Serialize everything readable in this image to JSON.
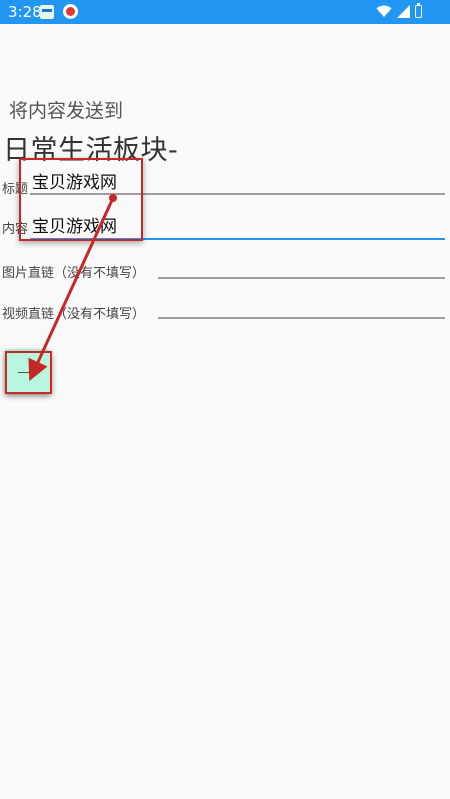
{
  "status_bar": {
    "time": "3:28",
    "icons": [
      "notification-app-icon",
      "red-badge-app-icon",
      "wifi-icon",
      "cellular-signal-icon",
      "battery-icon"
    ]
  },
  "page": {
    "subtitle": "将内容发送到",
    "board_title": "日常生活板块-"
  },
  "form": {
    "title_label": "标题",
    "title_value": "宝贝游戏网",
    "content_label": "内容",
    "content_value": "宝贝游戏网",
    "image_label": "图片直链（没有不填写）",
    "image_value": "",
    "video_label": "视频直链（没有不填写）",
    "video_value": "",
    "submit_label": ""
  },
  "annotation": {
    "color": "#c62828"
  }
}
